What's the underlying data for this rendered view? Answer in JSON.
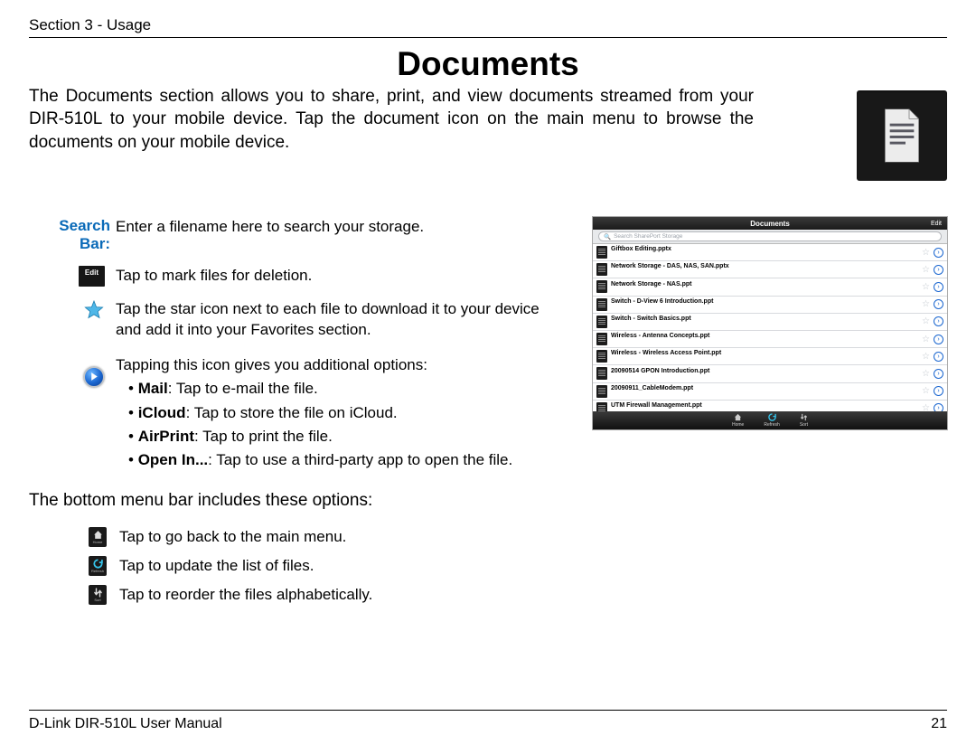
{
  "header": "Section 3 - Usage",
  "title": "Documents",
  "intro": "The Documents section allows you to share, print, and view documents streamed from your DIR-510L to your mobile device. Tap the document icon on the main menu to browse the documents on your mobile device.",
  "searchbar": {
    "label": "Search Bar:",
    "text": "Enter a filename here to search your storage."
  },
  "editbtn": {
    "label": "Edit",
    "text": "Tap to mark files for deletion."
  },
  "star": {
    "text": "Tap the star icon next to each file to download it to your device and add it into your Favorites section."
  },
  "optionsIntro": "Tapping this icon gives you additional options:",
  "opt_mail_b": "Mail",
  "opt_mail_t": ": Tap to e-mail the file.",
  "opt_icloud_b": "iCloud",
  "opt_icloud_t": ": Tap to store the file on iCloud.",
  "opt_air_b": "AirPrint",
  "opt_air_t": ": Tap to print the file.",
  "opt_open_b": "Open In...",
  "opt_open_t": ": Tap to use a third-party app to open the file.",
  "bottomNote": "The bottom menu bar includes these options:",
  "menu": {
    "home": "Tap to go back to the main menu.",
    "refresh": "Tap to update the list of files.",
    "sort": "Tap to reorder the files alphabetically.",
    "homeLabel": "Home",
    "refreshLabel": "Refresh",
    "sortLabel": "Sort"
  },
  "footer": {
    "left": "D-Link DIR-510L User Manual",
    "right": "21"
  },
  "mock": {
    "title": "Documents",
    "edit": "Edit",
    "searchPlaceholder": "Search SharePort Storage",
    "rows": [
      {
        "t": "Giftbox Editing.pptx",
        "s": ""
      },
      {
        "t": "Network Storage - DAS, NAS, SAN.pptx",
        "s": ""
      },
      {
        "t": "Network Storage - NAS.ppt",
        "s": ""
      },
      {
        "t": "Switch - D-View 6 Introduction.ppt",
        "s": ""
      },
      {
        "t": "Switch - Switch Basics.ppt",
        "s": ""
      },
      {
        "t": "Wireless - Antenna Concepts.ppt",
        "s": ""
      },
      {
        "t": "Wireless - Wireless Access Point.ppt",
        "s": ""
      },
      {
        "t": "20090514 GPON Introduction.ppt",
        "s": ""
      },
      {
        "t": "20090911_CableModem.ppt",
        "s": ""
      },
      {
        "t": "UTM Firewall Management.ppt",
        "s": ""
      }
    ],
    "bar": {
      "home": "Home",
      "refresh": "Refresh",
      "sort": "Sort"
    }
  }
}
